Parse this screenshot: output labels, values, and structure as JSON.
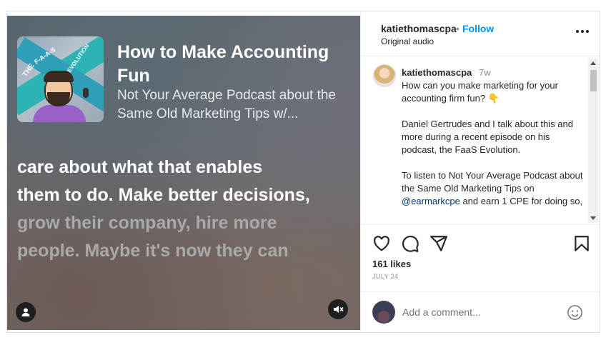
{
  "media": {
    "thumbnail_text": {
      "left": "THE",
      "middle": "F-A-A-S",
      "right": "EVOLUTION"
    },
    "episode_title": "How to Make Accounting Fun",
    "episode_subtitle": "Not Your Average Podcast about the Same Old Marketing Tips w/...",
    "caption_active_1": "care about what that enables",
    "caption_active_2": "them to do. Make better decisions,",
    "caption_dim_1": "grow their company, hire more",
    "caption_dim_2": "people. Maybe it's now they can",
    "icons": {
      "profile": "user-icon",
      "mute": "speaker-muted-icon"
    }
  },
  "header": {
    "username": "katiethomascpa",
    "separator": "•",
    "follow": "Follow",
    "audio": "Original audio",
    "more_icon": "more-horizontal-icon"
  },
  "comment": {
    "username": "katiethomascpa",
    "time": "7w",
    "paragraph1": "How can you make marketing for your accounting firm fun? 👇",
    "paragraph2": "Daniel Gertrudes and I talk about this and more during a recent episode on his podcast, the FaaS Evolution.",
    "paragraph3_before": "To listen to Not Your Average Podcast about the Same Old Marketing Tips on ",
    "mention": "@earmarkcpe",
    "paragraph3_after": " and earn 1 CPE for doing so,"
  },
  "actions": {
    "icons": [
      "heart-icon",
      "comment-icon",
      "share-icon",
      "bookmark-icon"
    ],
    "likes": "161 likes",
    "date": "JULY 24"
  },
  "composer": {
    "placeholder": "Add a comment...",
    "emoji_icon": "smiley-icon"
  }
}
